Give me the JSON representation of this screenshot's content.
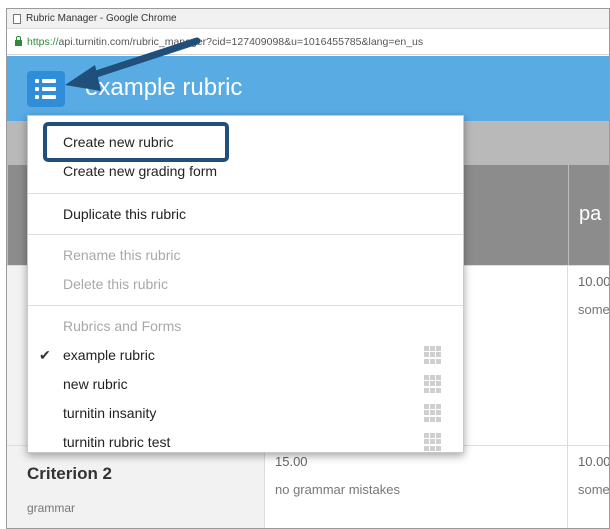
{
  "window": {
    "title": "Rubric Manager - Google Chrome"
  },
  "address": {
    "https": "https://",
    "url_rest": "api.turnitin.com/rubric_manager?cid=127409098&u=1016455785&lang=en_us"
  },
  "header": {
    "title": "example rubric"
  },
  "table": {
    "partial_header": "pa",
    "rows": [
      {
        "right_score": "10.00",
        "right_desc": "some"
      },
      {
        "name": "Criterion 2",
        "desc": "grammar",
        "mid_score": "15.00",
        "mid_desc": "no grammar mistakes",
        "right_score": "10.00",
        "right_desc": "some"
      }
    ]
  },
  "menu": {
    "create_new_rubric": "Create new rubric",
    "create_new_grading_form": "Create new grading form",
    "duplicate": "Duplicate this rubric",
    "rename": "Rename this rubric",
    "delete": "Delete this rubric",
    "section_label": "Rubrics and Forms",
    "checkmark": "✔",
    "items": [
      "example rubric",
      "new rubric",
      "turnitin insanity",
      "turnitin rubric test"
    ]
  },
  "colors": {
    "header_blue": "#59abe3",
    "menu_button": "#2f8ed7",
    "annotation": "#1f4f7a"
  }
}
